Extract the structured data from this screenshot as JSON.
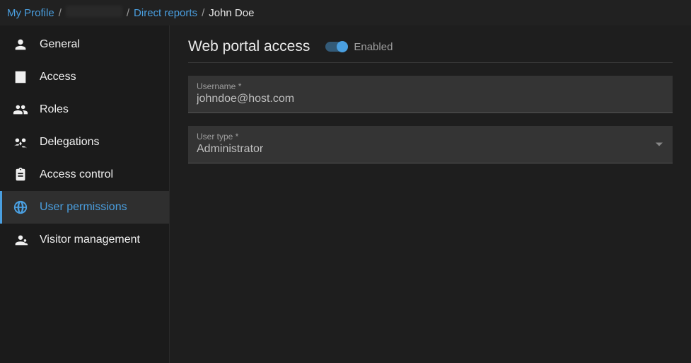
{
  "breadcrumb": {
    "items": [
      {
        "label": "My Profile",
        "link": true
      },
      {
        "label": "",
        "link": true,
        "obscured": true
      },
      {
        "label": "Direct reports",
        "link": true
      },
      {
        "label": "John Doe",
        "link": false
      }
    ]
  },
  "sidebar": {
    "items": [
      {
        "label": "General",
        "icon": "person-icon"
      },
      {
        "label": "Access",
        "icon": "building-icon"
      },
      {
        "label": "Roles",
        "icon": "group-icon"
      },
      {
        "label": "Delegations",
        "icon": "handoff-icon"
      },
      {
        "label": "Access control",
        "icon": "clipboard-icon"
      },
      {
        "label": "User permissions",
        "icon": "globe-icon",
        "active": true
      },
      {
        "label": "Visitor management",
        "icon": "visitor-icon"
      }
    ]
  },
  "main": {
    "section_title": "Web portal access",
    "toggle": {
      "enabled": true,
      "label": "Enabled"
    },
    "username": {
      "label": "Username *",
      "value": "johndoe@host.com"
    },
    "usertype": {
      "label": "User type *",
      "value": "Administrator"
    }
  }
}
